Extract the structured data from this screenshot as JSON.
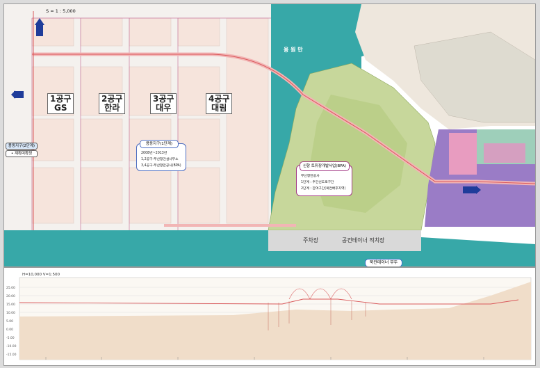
{
  "scale": "S = 1 : 5,000",
  "north_label": "N",
  "districts": [
    {
      "line1": "1공구",
      "line2": "GS"
    },
    {
      "line1": "2공구",
      "line2": "한라"
    },
    {
      "line1": "3공구",
      "line2": "대우"
    },
    {
      "line1": "4공구",
      "line2": "대림"
    }
  ],
  "side_tags": {
    "left_upper": "용동지구(2단계)",
    "left_lower": "• 계획미확정"
  },
  "legend_box": {
    "title": "용동지구(1단계)",
    "items": [
      "2008년~2013년",
      "1,2공구-부산항건설사무소",
      "3,4공구-부산항만공사(BPA)"
    ]
  },
  "new_port_box": {
    "title": "신항 토취장개발사업(BPA)",
    "items": [
      "부산항만공사",
      "1단계 : 주간선도로구간",
      "2단계 : 잔여구간(북컨배후지역)"
    ]
  },
  "water_labels": {
    "bay": "용 원 만"
  },
  "ground_labels": {
    "parking": "주차장",
    "container_yard": "공컨테이너 적치장"
  },
  "bottom_tag": "북컨테이너 부두",
  "profile": {
    "scale_text": "H=10,000  V=1:500",
    "y_ticks": [
      "25.00",
      "20.00",
      "15.00",
      "10.00",
      "5.00",
      "0.00",
      "-5.00",
      "-10.00",
      "-15.00"
    ]
  },
  "colors": {
    "sea": "#37a8a8",
    "land_green": "#c7d79b",
    "port_purple": "#9a7cc6",
    "road_red": "#d9585a",
    "district_pink": "#f7e0d8"
  }
}
